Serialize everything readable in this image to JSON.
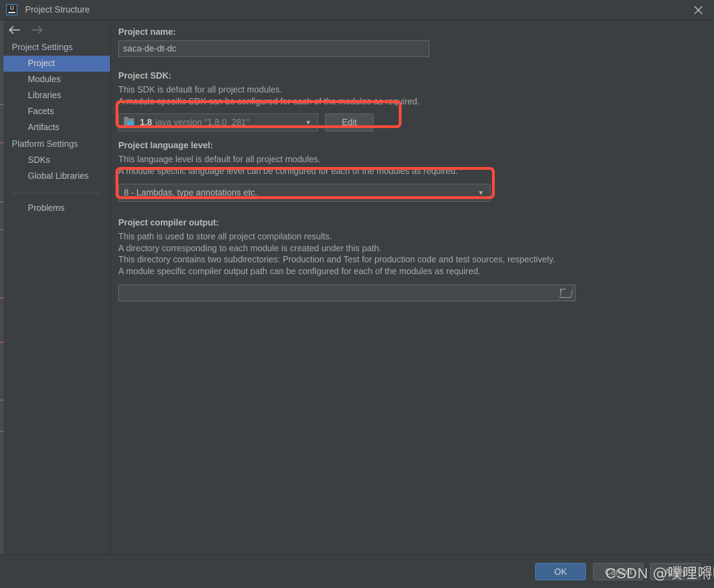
{
  "window": {
    "title": "Project Structure",
    "logo_text": "IJ",
    "close_icon": "close-icon"
  },
  "toolbar": {
    "back_icon": "arrow-left-icon",
    "forward_icon": "arrow-right-icon"
  },
  "sidebar": {
    "groups": [
      {
        "label": "Project Settings",
        "items": [
          {
            "label": "Project",
            "selected": true
          },
          {
            "label": "Modules",
            "selected": false
          },
          {
            "label": "Libraries",
            "selected": false
          },
          {
            "label": "Facets",
            "selected": false
          },
          {
            "label": "Artifacts",
            "selected": false
          }
        ]
      },
      {
        "label": "Platform Settings",
        "items": [
          {
            "label": "SDKs",
            "selected": false
          },
          {
            "label": "Global Libraries",
            "selected": false
          }
        ]
      }
    ],
    "problems": "Problems"
  },
  "main": {
    "project_name": {
      "label": "Project name:",
      "value": "saca-de-dt-dc",
      "placeholder": ""
    },
    "project_sdk": {
      "label": "Project SDK:",
      "desc_line1": "This SDK is default for all project modules.",
      "desc_line2": "A module specific SDK can be configured for each of the modules as required.",
      "sdk_icon": "java-sdk-folder-icon",
      "sdk_version": "1.8",
      "sdk_description": "java version \"1.8.0_281\"",
      "dropdown_icon": "chevron-down-icon",
      "edit_button": "Edit"
    },
    "language_level": {
      "label": "Project language level:",
      "desc_line1": "This language level is default for all project modules.",
      "desc_line2": "A module specific language level can be configured for each of the modules as required.",
      "value": "8 - Lambdas, type annotations etc.",
      "dropdown_icon": "chevron-down-icon"
    },
    "compiler_output": {
      "label": "Project compiler output:",
      "desc_line1": "This path is used to store all project compilation results.",
      "desc_line2": "A directory corresponding to each module is created under this path.",
      "desc_line3": "This directory contains two subdirectories: Production and Test for production code and test sources, respectively.",
      "desc_line4": "A module specific compiler output path can be configured for each of the modules as required.",
      "value": "",
      "placeholder": "",
      "browse_icon": "folder-browse-icon"
    }
  },
  "footer": {
    "ok": "OK",
    "cancel": "Cancel",
    "apply": "Apply"
  },
  "watermark": {
    "brand": "CSDN",
    "handle": "@噗哩嘚啦"
  },
  "colors": {
    "background": "#3c3f41",
    "selection": "#4b6eaf",
    "annotation": "#fc4b3c",
    "ok_button": "#3e6492",
    "field": "#45484a",
    "text": "#bbbbbb"
  }
}
